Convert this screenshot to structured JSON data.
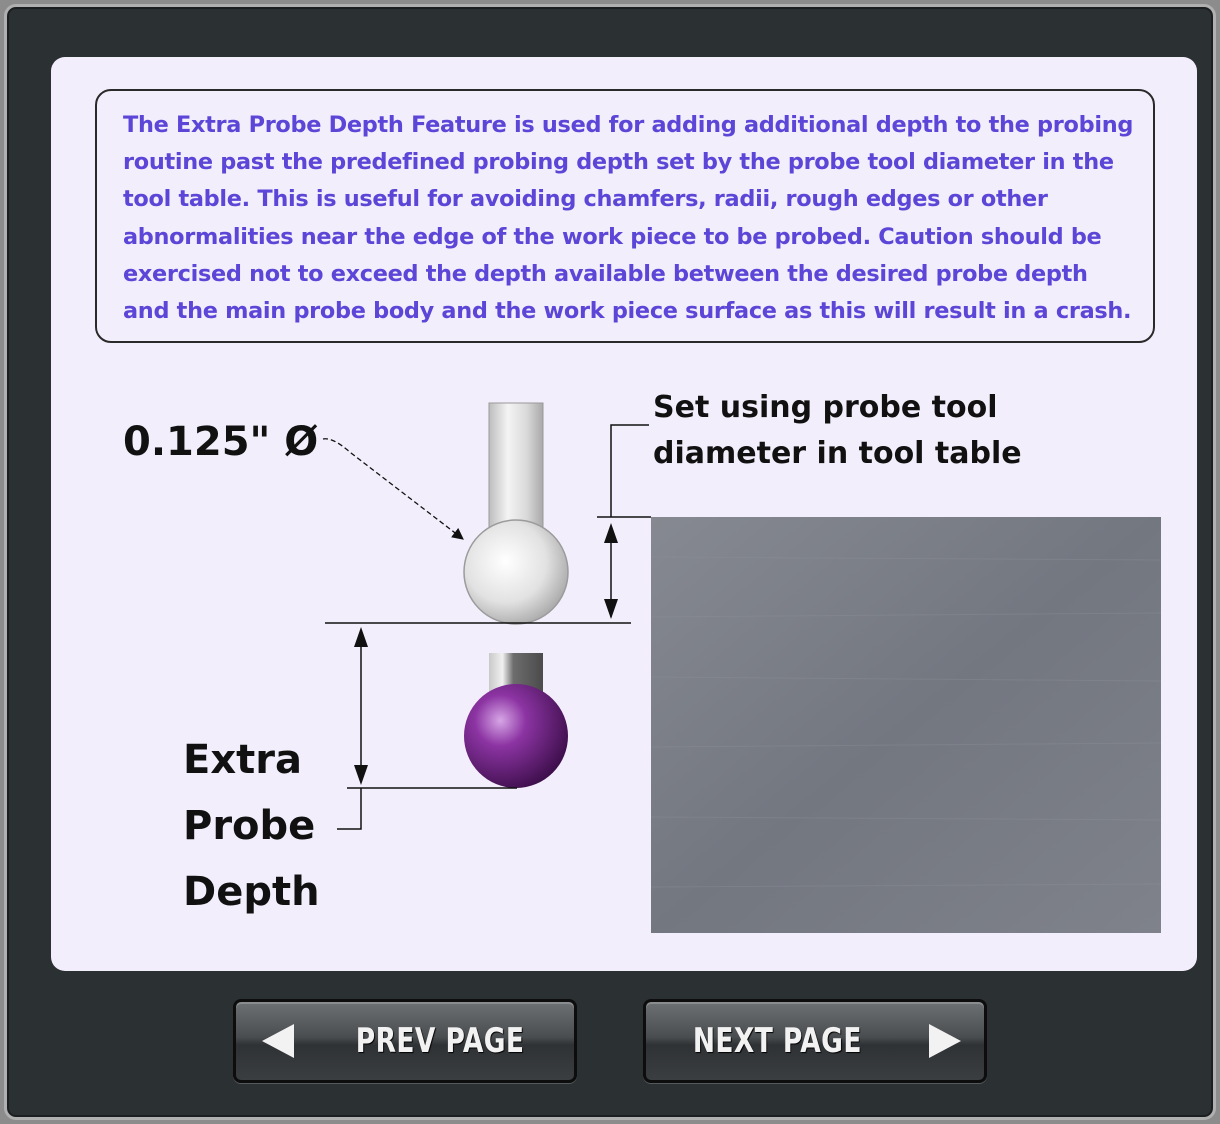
{
  "description": "The Extra Probe Depth Feature is used for adding additional depth to the probing\nroutine past the predefined probing depth set by the probe tool diameter in the\ntool table.  This is useful for avoiding chamfers, radii, rough edges or other\nabnormalities near the edge of the work piece to be probed.  Caution should be\nexercised not to exceed the depth available between the desired probe depth\nand the main probe body and the work piece surface as this will result in a crash.",
  "diagram": {
    "diameter_label": "0.125\" Ø",
    "set_using_line1": "Set using probe tool",
    "set_using_line2": "diameter in tool table",
    "extra_label_line1": "Extra",
    "extra_label_line2": "Probe",
    "extra_label_line3": "Depth"
  },
  "nav": {
    "prev_label": "PREV PAGE",
    "next_label": "NEXT PAGE",
    "prev_icon": "triangle-left-icon",
    "next_icon": "triangle-right-icon"
  },
  "colors": {
    "description_text": "#5b46d8",
    "panel_bg": "#f3eefb",
    "frame_bg": "#2b3033",
    "probe_ball": "#7a2a8c",
    "workpiece": "#7b7e85"
  }
}
